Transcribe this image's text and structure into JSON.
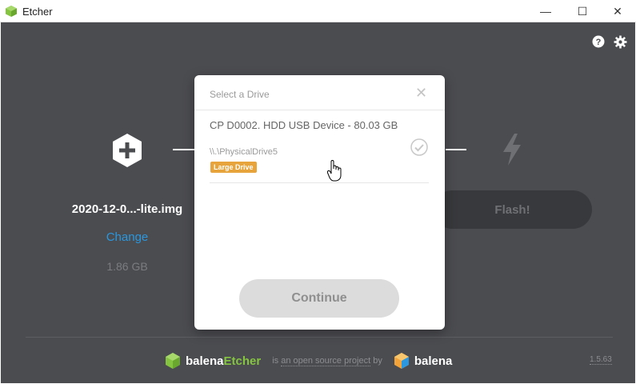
{
  "window": {
    "title": "Etcher",
    "controls": {
      "minimize": "—",
      "maximize": "☐",
      "close": "✕"
    }
  },
  "header_icons": [
    "help-icon",
    "settings-icon"
  ],
  "image_step": {
    "filename": "2020-12-0...-lite.img",
    "change_label": "Change",
    "size": "1.86 GB"
  },
  "flash_step": {
    "button_label": "Flash!"
  },
  "modal": {
    "title": "Select a Drive",
    "close_glyph": "✕",
    "drives": [
      {
        "name": "CP D0002. HDD USB Device - 80.03 GB",
        "path": "\\\\.\\PhysicalDrive5",
        "badge": "Large Drive"
      }
    ],
    "continue_label": "Continue"
  },
  "footer": {
    "brand_prefix": "balena",
    "brand_suffix": "Etcher",
    "text_before": "is ",
    "link_text": "an open source project",
    "text_after": " by",
    "company": "balena",
    "version": "1.5.63"
  },
  "colors": {
    "background": "#4b4c50",
    "accent_blue": "#2a97de",
    "brand_green": "#85c441",
    "badge_orange": "#e7a43c"
  }
}
